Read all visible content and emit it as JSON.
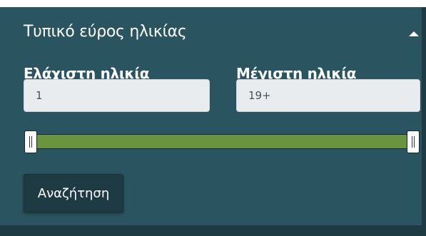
{
  "filter": {
    "title": "Τυπικό εύρος ηλικίας",
    "collapse_icon": "caret-up-icon",
    "min_age": {
      "label": "Ελάχιστη ηλικία",
      "value": "1"
    },
    "max_age": {
      "label": "Μέγιστη ηλικία",
      "value": "19+"
    },
    "slider": {
      "min_fraction": 0.0,
      "max_fraction": 1.0,
      "handle_icon": "grip-lines-icon"
    },
    "search_label": "Αναζήτηση"
  },
  "colors": {
    "panel_background": "#2a545f",
    "range_fill": "#6b9441",
    "button_background": "#1e3b44",
    "field_background": "#e9ecef"
  }
}
